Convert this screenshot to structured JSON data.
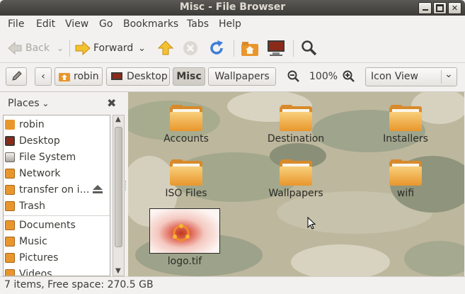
{
  "window": {
    "title": "Misc - File Browser"
  },
  "menu": [
    {
      "label": "File"
    },
    {
      "label": "Edit"
    },
    {
      "label": "View"
    },
    {
      "label": "Go"
    },
    {
      "label": "Bookmarks"
    },
    {
      "label": "Tabs"
    },
    {
      "label": "Help"
    }
  ],
  "toolbar": {
    "back_label": "Back",
    "forward_label": "Forward"
  },
  "path": {
    "segments": [
      {
        "label": "robin"
      },
      {
        "label": "Desktop"
      },
      {
        "label": "Misc"
      },
      {
        "label": "Wallpapers"
      }
    ],
    "current": "Misc",
    "zoom": "100%",
    "view_mode": "Icon View"
  },
  "sidebar": {
    "header": "Places",
    "items": [
      {
        "label": "robin",
        "icon": "home-folder-icon"
      },
      {
        "label": "Desktop",
        "icon": "desktop-icon"
      },
      {
        "label": "File System",
        "icon": "drive-icon"
      },
      {
        "label": "Network",
        "icon": "network-icon"
      },
      {
        "label": "transfer on i…",
        "icon": "network-share-icon"
      },
      {
        "label": "Trash",
        "icon": "trash-icon"
      },
      {
        "label": "Documents",
        "icon": "documents-folder-icon"
      },
      {
        "label": "Music",
        "icon": "music-folder-icon"
      },
      {
        "label": "Pictures",
        "icon": "pictures-folder-icon"
      },
      {
        "label": "Videos",
        "icon": "videos-folder-icon"
      }
    ]
  },
  "files": [
    {
      "name": "Accounts",
      "type": "folder"
    },
    {
      "name": "Destination",
      "type": "folder"
    },
    {
      "name": "Installers",
      "type": "folder"
    },
    {
      "name": "ISO Files",
      "type": "folder"
    },
    {
      "name": "Wallpapers",
      "type": "folder"
    },
    {
      "name": "wifi",
      "type": "folder"
    },
    {
      "name": "logo.tif",
      "type": "image"
    }
  ],
  "status": {
    "text": "7 items, Free space: 270.5 GB"
  },
  "colors": {
    "folder": "#e9962c",
    "titlebar": "#3c3b37",
    "accent": "#dd4814"
  }
}
